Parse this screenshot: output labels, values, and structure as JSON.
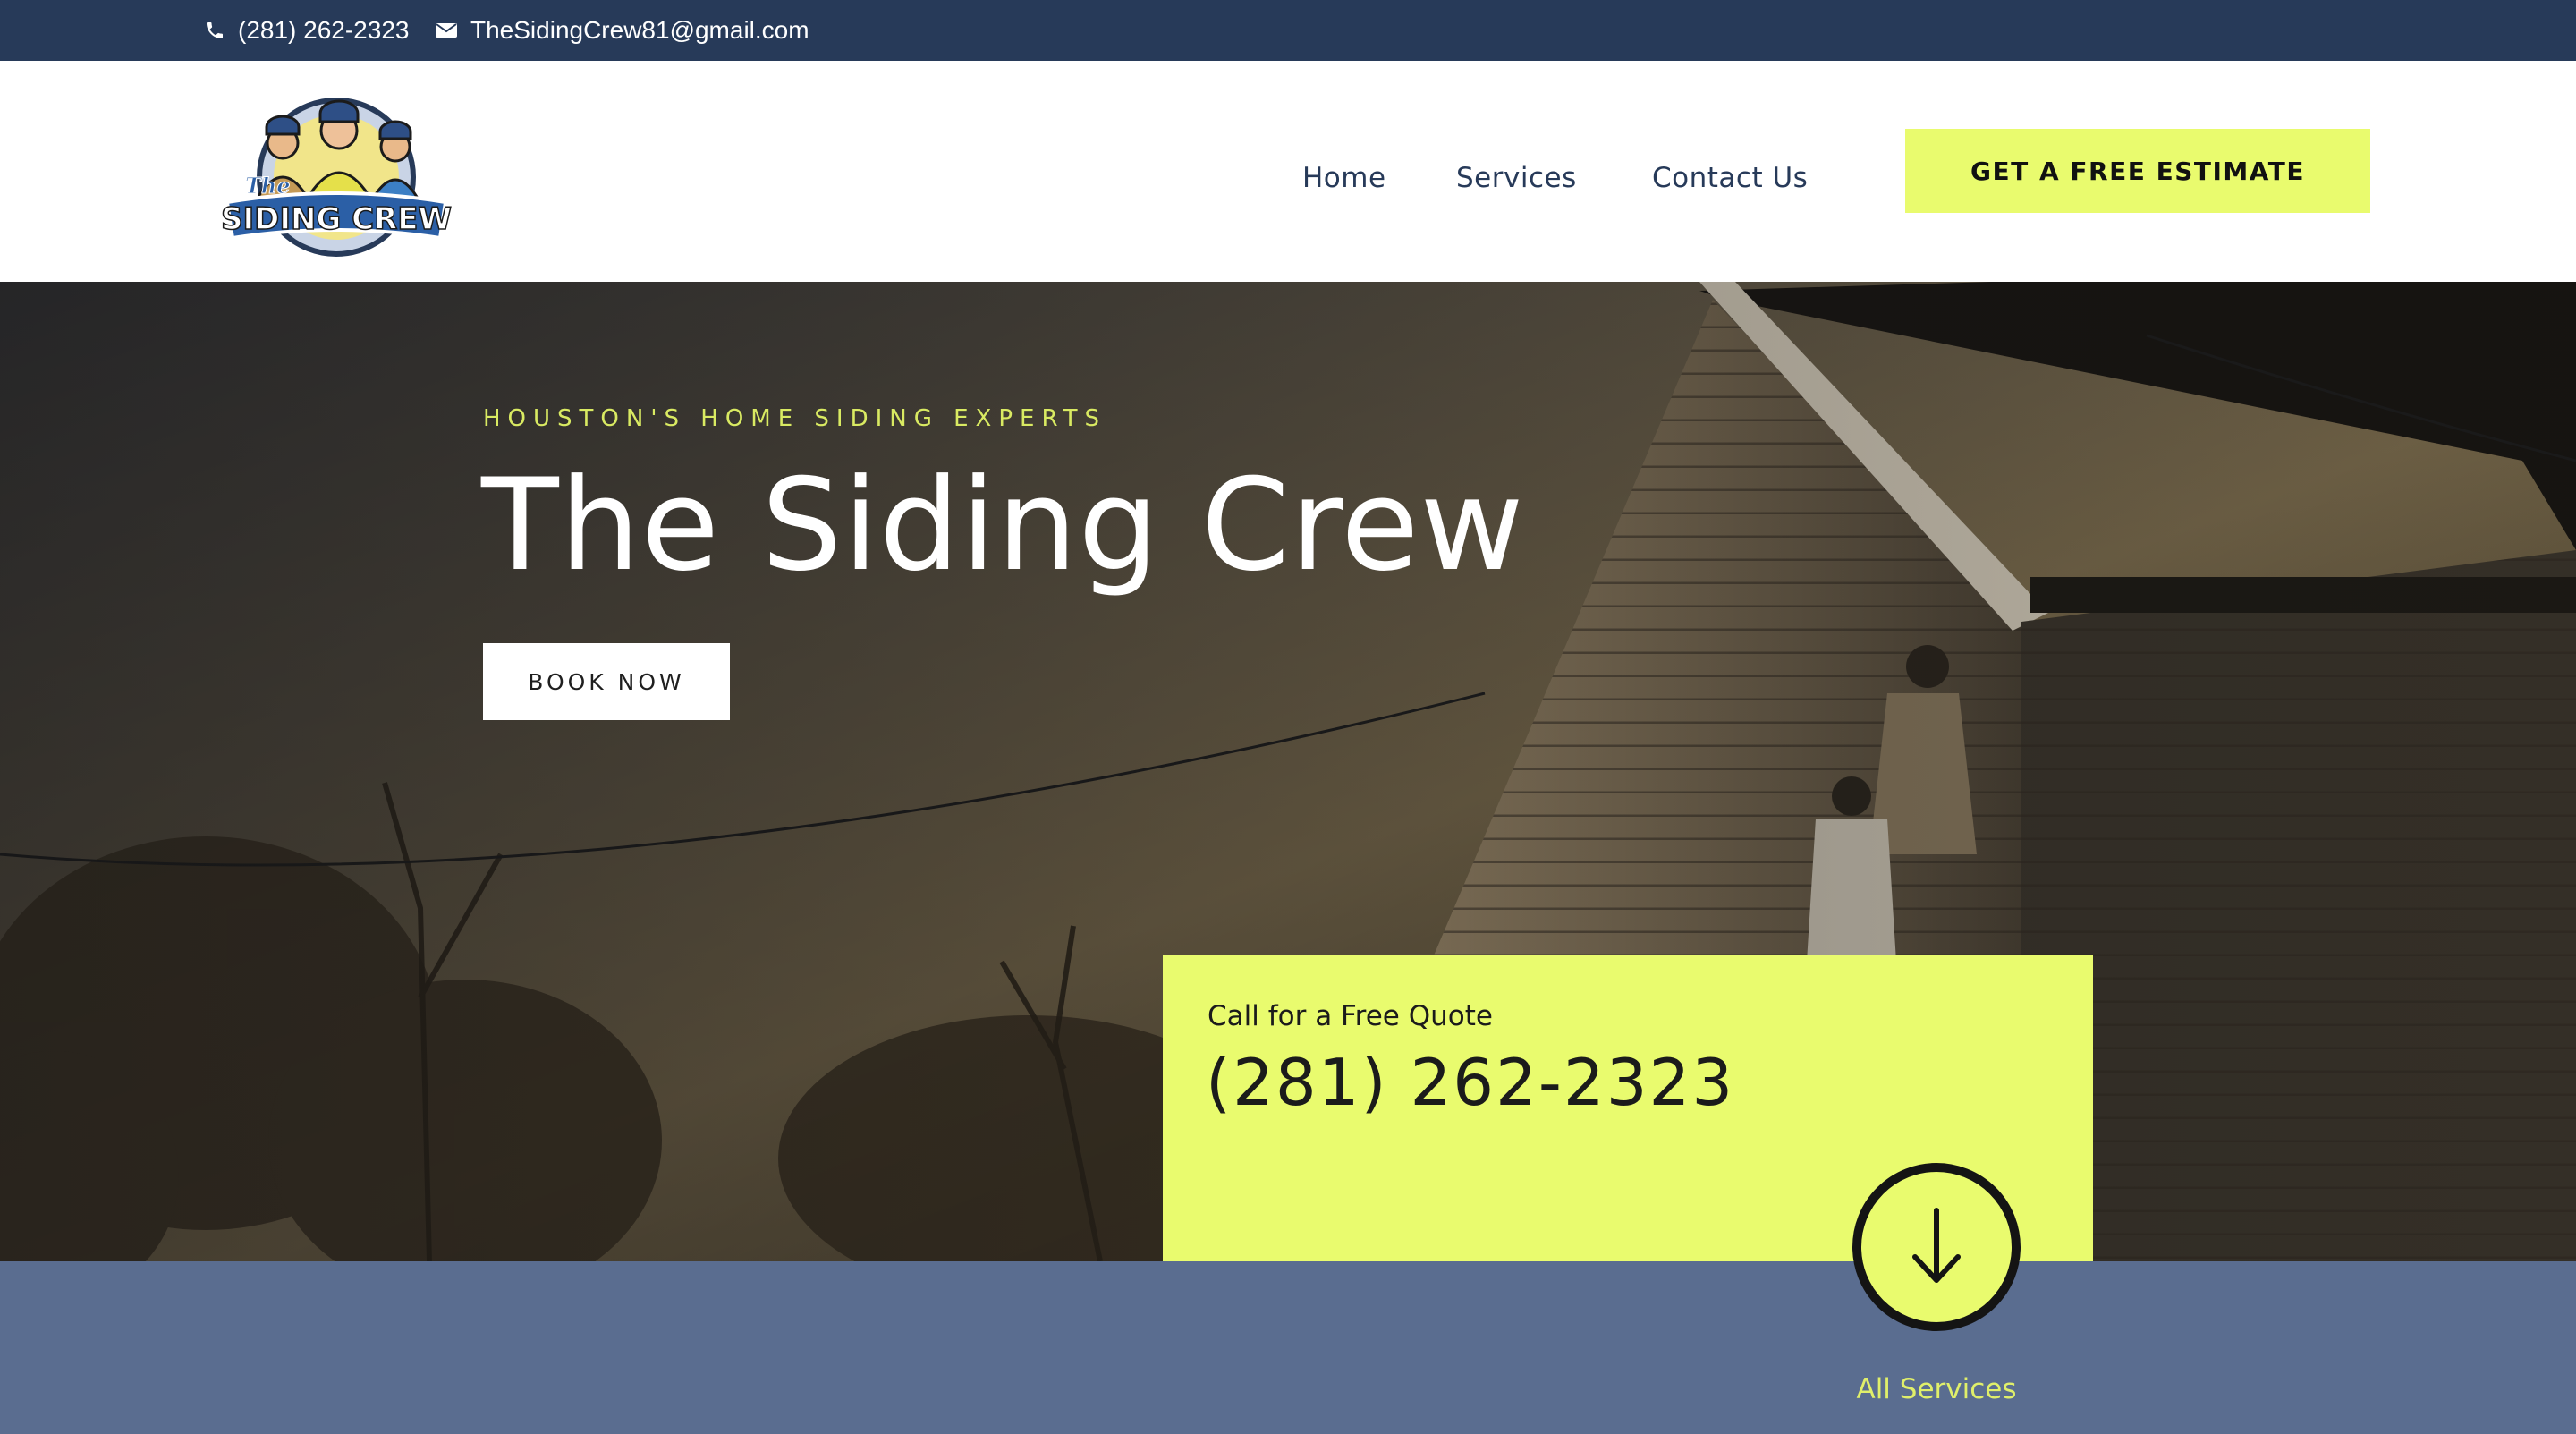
{
  "topbar": {
    "phone": "(281) 262-2323",
    "email": "TheSidingCrew81@gmail.com"
  },
  "header": {
    "logo_text": "The SIDING CREW",
    "nav": [
      {
        "label": "Home"
      },
      {
        "label": "Services"
      },
      {
        "label": "Contact Us"
      }
    ],
    "cta_label": "GET A FREE ESTIMATE"
  },
  "hero": {
    "eyebrow": "HOUSTON'S HOME SIDING EXPERTS",
    "title": "The Siding Crew",
    "book_label": "BOOK NOW"
  },
  "quote_card": {
    "label": "Call for a Free Quote",
    "phone": "(281) 262-2323"
  },
  "services_link": {
    "label": "All Services",
    "icon": "arrow-down-icon"
  },
  "colors": {
    "navy": "#273a59",
    "accent": "#e9fb6e",
    "band": "#5a6d90"
  }
}
